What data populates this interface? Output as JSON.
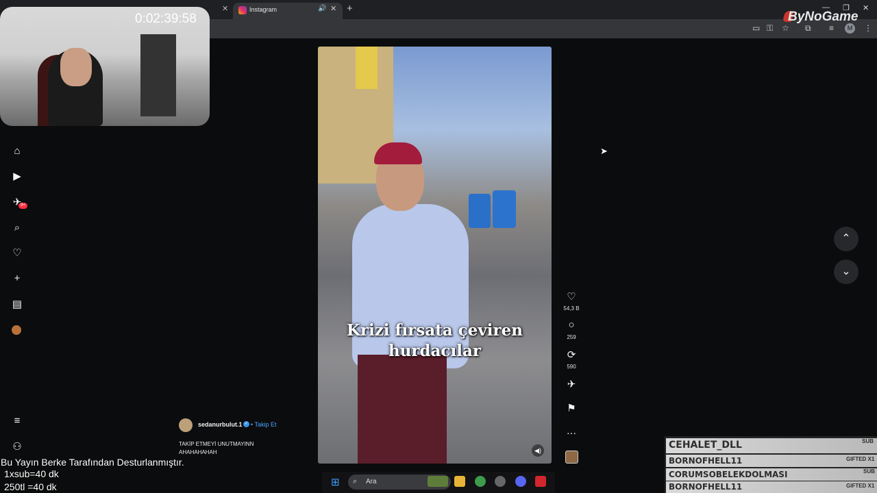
{
  "browser": {
    "active_tab_title": "Instagram",
    "new_tab": "+",
    "close": "✕",
    "speaker": "🔊",
    "profile_initial": "M"
  },
  "stream": {
    "timer": "0:02:39:58",
    "brand": "ByNoGame",
    "overlay_lines": [
      "Bu Yayın Berke Tarafından Desturlanmıştır.",
      "1xsub=40 dk",
      "250tl =40 dk"
    ]
  },
  "sidebar": {
    "badge": "9+",
    "icons": [
      "home-icon",
      "reels-icon",
      "messages-icon",
      "search-icon",
      "heart-icon",
      "create-icon",
      "dashboard-icon",
      "profile-avatar",
      "menu-icon",
      "more-icon"
    ]
  },
  "reel": {
    "caption_line1": "Krizi fırsata çeviren",
    "caption_line2": "hurdacılar",
    "author": "sedanurbulut.1",
    "follow_label": "Takip Et",
    "separator": "•",
    "description_line1": "TAKİP ETMEYİ UNUTMAYINN",
    "description_line2": "AHAHAHAHAH",
    "likes": "54,3 B",
    "comments": "259",
    "reposts": "590"
  },
  "taskbar": {
    "search_label": "Ara"
  },
  "subs": {
    "rows": [
      {
        "name": "CEHALET_DLL",
        "tag": "SUB"
      },
      {
        "name": "BORNOFHELL11",
        "tag": "GIFTED X1"
      },
      {
        "name": "CORUMSOBELEKDOLMASI",
        "tag": "SUB"
      },
      {
        "name": "BORNOFHELL11",
        "tag": "GIFTED X1"
      }
    ]
  },
  "colors": {
    "accent_blue": "#4aa3ff",
    "badge_red": "#ff3040",
    "background": "#0b0c0d"
  }
}
